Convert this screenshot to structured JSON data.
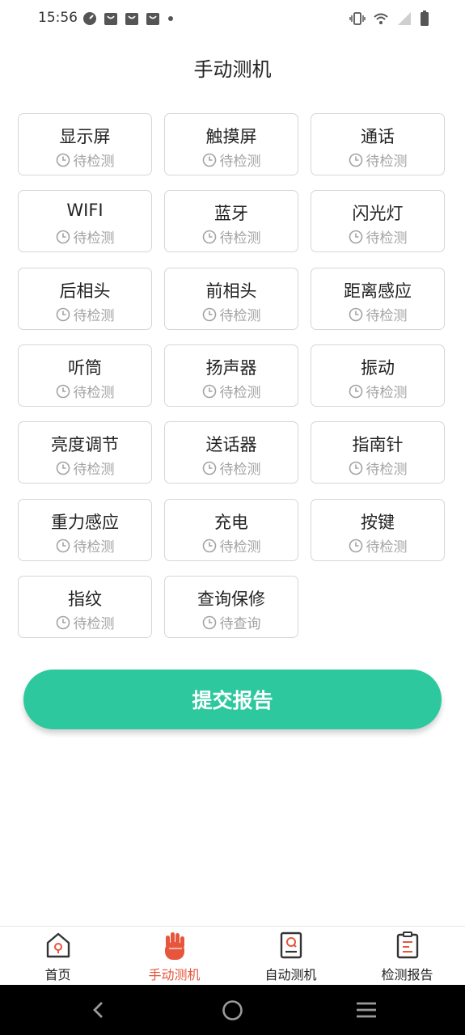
{
  "status_bar": {
    "time": "15:56",
    "left_icons": [
      "speed-icon",
      "bag-icon",
      "bag-icon",
      "bag-icon",
      "dot-icon"
    ],
    "right_icons": [
      "vibrate-icon",
      "wifi-icon",
      "signal-icon",
      "battery-icon"
    ]
  },
  "header": {
    "title": "手动测机"
  },
  "tests": [
    {
      "name": "显示屏",
      "status": "待检测"
    },
    {
      "name": "触摸屏",
      "status": "待检测"
    },
    {
      "name": "通话",
      "status": "待检测"
    },
    {
      "name": "WIFI",
      "status": "待检测"
    },
    {
      "name": "蓝牙",
      "status": "待检测"
    },
    {
      "name": "闪光灯",
      "status": "待检测"
    },
    {
      "name": "后相头",
      "status": "待检测"
    },
    {
      "name": "前相头",
      "status": "待检测"
    },
    {
      "name": "距离感应",
      "status": "待检测"
    },
    {
      "name": "听筒",
      "status": "待检测"
    },
    {
      "name": "扬声器",
      "status": "待检测"
    },
    {
      "name": "振动",
      "status": "待检测"
    },
    {
      "name": "亮度调节",
      "status": "待检测"
    },
    {
      "name": "送话器",
      "status": "待检测"
    },
    {
      "name": "指南针",
      "status": "待检测"
    },
    {
      "name": "重力感应",
      "status": "待检测"
    },
    {
      "name": "充电",
      "status": "待检测"
    },
    {
      "name": "按键",
      "status": "待检测"
    },
    {
      "name": "指纹",
      "status": "待检测"
    },
    {
      "name": "查询保修",
      "status": "待查询"
    }
  ],
  "submit": {
    "label": "提交报告"
  },
  "bottom_nav": {
    "items": [
      {
        "label": "首页",
        "icon": "home-icon",
        "active": false
      },
      {
        "label": "手动测机",
        "icon": "hand-icon",
        "active": true
      },
      {
        "label": "自动测机",
        "icon": "auto-test-icon",
        "active": false
      },
      {
        "label": "检测报告",
        "icon": "report-icon",
        "active": false
      }
    ],
    "active_color": "#e8553d"
  },
  "system_nav": [
    "back-icon",
    "home-circle-icon",
    "menu-icon"
  ],
  "colors": {
    "accent": "#2ec89f",
    "status_text": "#a3a3a3"
  }
}
